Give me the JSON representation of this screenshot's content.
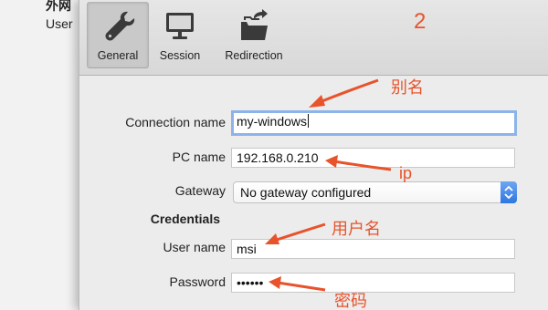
{
  "background_window": {
    "title": "外网",
    "user_label": "User"
  },
  "toolbar": {
    "items": [
      {
        "label": "General",
        "icon": "wrench-icon",
        "active": true
      },
      {
        "label": "Session",
        "icon": "monitor-icon",
        "active": false
      },
      {
        "label": "Redirection",
        "icon": "folder-redirect-icon",
        "active": false
      }
    ]
  },
  "form": {
    "connection_name": {
      "label": "Connection name",
      "value": "my-windows"
    },
    "pc_name": {
      "label": "PC name",
      "value": "192.168.0.210"
    },
    "gateway": {
      "label": "Gateway",
      "value": "No gateway configured"
    },
    "credentials_heading": "Credentials",
    "user_name": {
      "label": "User name",
      "value": "msi"
    },
    "password": {
      "label": "Password",
      "value": "••••••"
    }
  },
  "annotations": {
    "number": "2",
    "alias": "别名",
    "ip": "ip",
    "username": "用户名",
    "password": "密码"
  },
  "colors": {
    "annotation": "#e8532b",
    "focus_ring": "#8cb4e8",
    "select_accent": "#2f76e0"
  }
}
